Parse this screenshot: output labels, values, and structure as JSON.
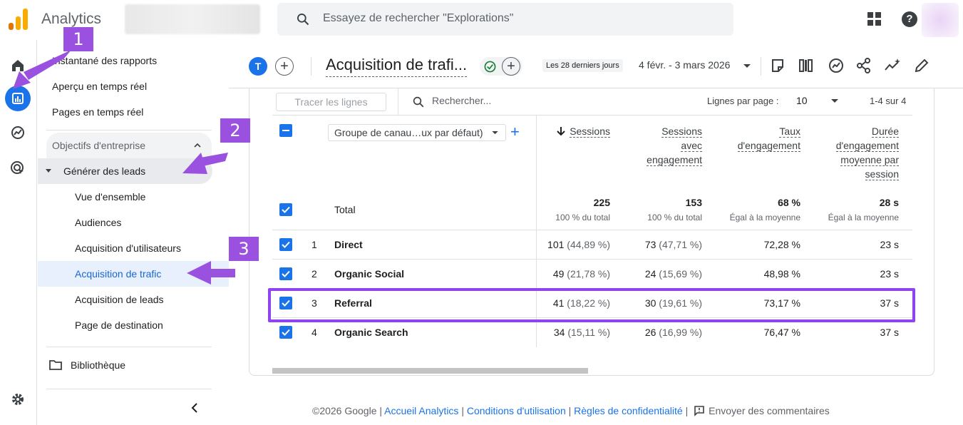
{
  "topbar": {
    "app_title": "Analytics",
    "search_placeholder": "Essayez de rechercher \"Explorations\"",
    "logo_colors": [
      "#f9ab00",
      "#e37400"
    ]
  },
  "nav": {
    "items": [
      {
        "label": "Instantané des rapports"
      },
      {
        "label": "Aperçu en temps réel"
      },
      {
        "label": "Pages en temps réel"
      }
    ],
    "section_label": "Objectifs d'entreprise",
    "subsection_label": "Générer des leads",
    "sub_items": [
      {
        "label": "Vue d'ensemble"
      },
      {
        "label": "Audiences"
      },
      {
        "label": "Acquisition d'utilisateurs"
      },
      {
        "label": "Acquisition de trafic",
        "active": true
      },
      {
        "label": "Acquisition de leads"
      },
      {
        "label": "Page de destination"
      }
    ],
    "library_label": "Bibliothèque"
  },
  "report": {
    "avatar_letter": "T",
    "title": "Acquisition de trafi...",
    "date_chip": "Les 28 derniers jours",
    "date_range": "4 févr. - 3 mars 2026"
  },
  "table": {
    "trace_button": "Tracer les lignes",
    "search_placeholder": "Rechercher...",
    "rows_per_page_label": "Lignes par page :",
    "rows_per_page_value": "10",
    "pager": "1-4 sur 4",
    "dimension_select": "Groupe de canau…ux par défaut)",
    "columns": {
      "sessions": "Sessions",
      "engaged_1": "Sessions",
      "engaged_2": "avec",
      "engaged_3": "engagement",
      "rate_1": "Taux",
      "rate_2": "d'engagement",
      "dur_1": "Durée",
      "dur_2": "d'engagement",
      "dur_3": "moyenne par",
      "dur_4": "session"
    },
    "total": {
      "label": "Total",
      "sessions": "225",
      "sessions_sub": "100 % du total",
      "engaged": "153",
      "engaged_sub": "100 % du total",
      "rate": "68 %",
      "rate_sub": "Égal à la moyenne",
      "duration": "28 s",
      "duration_sub": "Égal à la moyenne"
    },
    "rows": [
      {
        "idx": "1",
        "channel": "Direct",
        "sessions": "101",
        "sessions_pct": "(44,89 %)",
        "engaged": "73",
        "engaged_pct": "(47,71 %)",
        "rate": "72,28 %",
        "duration": "23 s"
      },
      {
        "idx": "2",
        "channel": "Organic Social",
        "sessions": "49",
        "sessions_pct": "(21,78 %)",
        "engaged": "24",
        "engaged_pct": "(15,69 %)",
        "rate": "48,98 %",
        "duration": "23 s"
      },
      {
        "idx": "3",
        "channel": "Referral",
        "sessions": "41",
        "sessions_pct": "(18,22 %)",
        "engaged": "30",
        "engaged_pct": "(19,61 %)",
        "rate": "73,17 %",
        "duration": "37 s"
      },
      {
        "idx": "4",
        "channel": "Organic Search",
        "sessions": "34",
        "sessions_pct": "(15,11 %)",
        "engaged": "26",
        "engaged_pct": "(16,99 %)",
        "rate": "76,47 %",
        "duration": "37 s"
      }
    ]
  },
  "annotations": {
    "badge1": "1",
    "badge2": "2",
    "badge3": "3",
    "color": "#9b51e0"
  },
  "footer": {
    "copyright": "©2026 Google",
    "sep": " | ",
    "link1": "Accueil Analytics",
    "link2": "Conditions d'utilisation",
    "link3": "Règles de confidentialité",
    "feedback": "Envoyer des commentaires"
  }
}
